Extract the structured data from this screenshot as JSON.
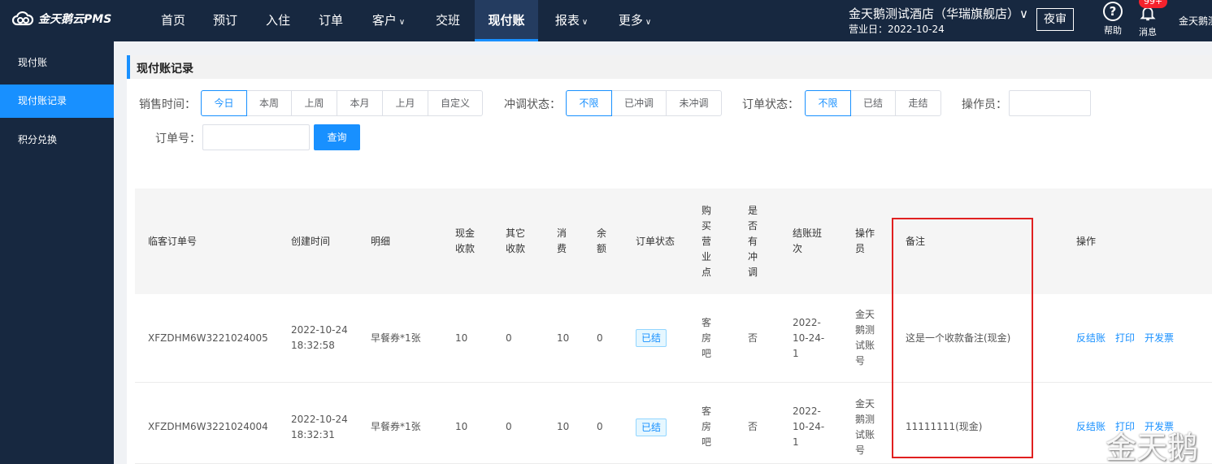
{
  "brand": {
    "logo_text": "金天鹅云PMS",
    "accent": "#1890ff",
    "nav_bg": "#172840"
  },
  "nav": [
    {
      "label": "首页",
      "caret": ""
    },
    {
      "label": "预订",
      "caret": ""
    },
    {
      "label": "入住",
      "caret": ""
    },
    {
      "label": "订单",
      "caret": ""
    },
    {
      "label": "客户",
      "caret": "∨"
    },
    {
      "label": "交班",
      "caret": ""
    },
    {
      "label": "现付账",
      "caret": ""
    },
    {
      "label": "报表",
      "caret": "∨"
    },
    {
      "label": "更多",
      "caret": "∨"
    }
  ],
  "header": {
    "hotel": "金天鹅测试酒店（华瑞旗舰店）∨",
    "business_date": "营业日：2022-10-24",
    "night_audit": "夜审",
    "help_label": "帮助",
    "help_glyph": "?",
    "msg_label": "消息",
    "msg_badge": "99+",
    "user": "金天鹅测"
  },
  "sidebar": {
    "items": [
      {
        "label": "现付账"
      },
      {
        "label": "现付账记录"
      },
      {
        "label": "积分兑换"
      }
    ]
  },
  "page_title": "现付账记录",
  "filters": {
    "sale_time_label": "销售时间：",
    "sale_time_options": [
      "今日",
      "本周",
      "上周",
      "本月",
      "上月",
      "自定义"
    ],
    "sale_time_selected": "今日",
    "adjust_label": "冲调状态：",
    "adjust_options": [
      "不限",
      "已冲调",
      "未冲调"
    ],
    "adjust_selected": "不限",
    "order_status_label": "订单状态：",
    "order_status_options": [
      "不限",
      "已结",
      "走结"
    ],
    "order_status_selected": "不限",
    "operator_label": "操作员：",
    "operator_value": "",
    "order_no_label": "订单号：",
    "order_no_value": "",
    "query_label": "查询"
  },
  "table": {
    "headers": {
      "order_no": "临客订单号",
      "created": "创建时间",
      "detail": "明细",
      "cash": "现金收款",
      "other": "其它收款",
      "consume": "消费",
      "balance": "余额",
      "status": "订单状态",
      "point": "购买营业点",
      "adjusted": "是否有冲调",
      "shift": "结账班次",
      "operator": "操作员",
      "remark": "备注",
      "actions": "操作"
    },
    "rows": [
      {
        "order_no": "XFZDHM6W3221024005",
        "created": "2022-10-24 18:32:58",
        "detail": "早餐券*1张",
        "cash": "10",
        "other": "0",
        "consume": "10",
        "balance": "0",
        "status": "已结",
        "point": "客房吧",
        "adjusted": "否",
        "shift": "2022-10-24-1",
        "operator": "金天鹅测试账号",
        "remark": "这是一个收款备注(现金)",
        "actions": [
          "反结账",
          "打印",
          "开发票"
        ]
      },
      {
        "order_no": "XFZDHM6W3221024004",
        "created": "2022-10-24 18:32:31",
        "detail": "早餐券*1张",
        "cash": "10",
        "other": "0",
        "consume": "10",
        "balance": "0",
        "status": "已结",
        "point": "客房吧",
        "adjusted": "否",
        "shift": "2022-10-24-1",
        "operator": "金天鹅测试账号",
        "remark": "11111111(现金)",
        "actions": [
          "反结账",
          "打印",
          "开发票"
        ]
      }
    ]
  },
  "watermark": "金天鹅"
}
